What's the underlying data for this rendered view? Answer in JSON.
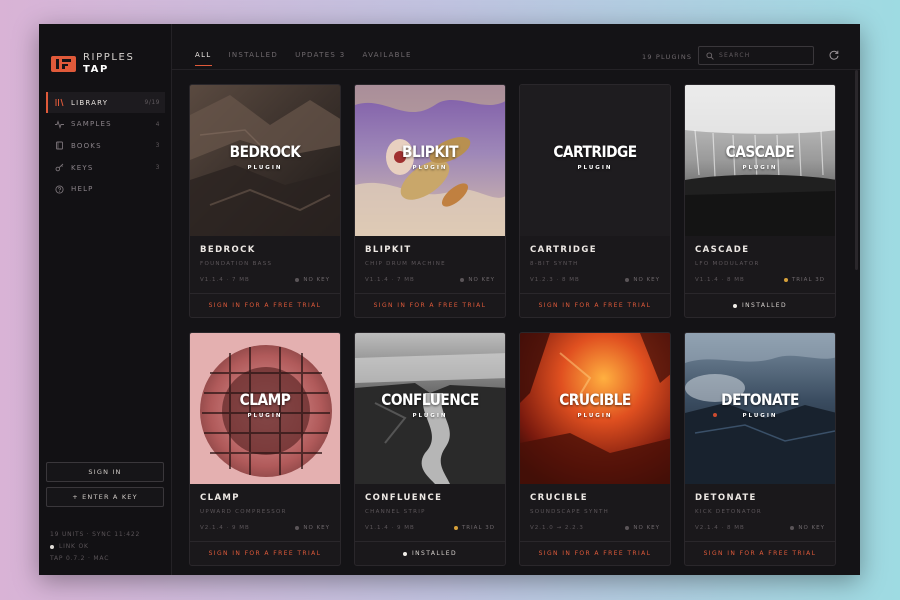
{
  "brand": {
    "line1": "RIPPLES",
    "line2": "TAP"
  },
  "sidebar": {
    "items": [
      {
        "label": "LIBRARY",
        "count": "9/19",
        "active": true,
        "icon": "library-icon"
      },
      {
        "label": "SAMPLES",
        "count": "4",
        "active": false,
        "icon": "waveform-icon"
      },
      {
        "label": "BOOKS",
        "count": "3",
        "active": false,
        "icon": "book-icon"
      },
      {
        "label": "KEYS",
        "count": "3",
        "active": false,
        "icon": "key-icon"
      },
      {
        "label": "HELP",
        "count": "",
        "active": false,
        "icon": "help-icon"
      }
    ],
    "sign_in_label": "SIGN IN",
    "enter_key_label": "+ ENTER A KEY",
    "footer": {
      "units": "19 UNITS · SYNC 11:422",
      "link": "LINK OK",
      "version": "TAP 0.7.2 · MAC"
    }
  },
  "topbar": {
    "tabs": [
      {
        "label": "ALL",
        "active": true
      },
      {
        "label": "INSTALLED",
        "active": false
      },
      {
        "label": "UPDATES 3",
        "active": false
      },
      {
        "label": "AVAILABLE",
        "active": false
      }
    ],
    "plugin_count": "19 PLUGINS",
    "search_placeholder": "SEARCH"
  },
  "colors": {
    "accent": "#e05a3a",
    "trial": "#d6a03a",
    "background": "#141316"
  },
  "plugins": [
    {
      "art_title": "BEDROCK",
      "art_sub": "PLUGIN",
      "name": "BEDROCK",
      "desc": "FOUNDATION BASS",
      "version": "V1.1.4 · 7 MB",
      "key": "NO KEY",
      "key_state": "none",
      "action": "SIGN IN FOR A FREE TRIAL",
      "installed": false
    },
    {
      "art_title": "BLIPKIT",
      "art_sub": "PLUGIN",
      "name": "BLIPKIT",
      "desc": "CHIP DRUM MACHINE",
      "version": "V1.1.4 · 7 MB",
      "key": "NO KEY",
      "key_state": "none",
      "action": "SIGN IN FOR A FREE TRIAL",
      "installed": false
    },
    {
      "art_title": "CARTRIDGE",
      "art_sub": "PLUGIN",
      "name": "CARTRIDGE",
      "desc": "8-BIT SYNTH",
      "version": "V1.2.3 · 8 MB",
      "key": "NO KEY",
      "key_state": "none",
      "action": "SIGN IN FOR A FREE TRIAL",
      "installed": false
    },
    {
      "art_title": "CASCADE",
      "art_sub": "PLUGIN",
      "name": "CASCADE",
      "desc": "LFO MODULATOR",
      "version": "V1.1.4 · 8 MB",
      "key": "TRIAL 3D",
      "key_state": "trial",
      "action": "INSTALLED",
      "installed": true
    },
    {
      "art_title": "CLAMP",
      "art_sub": "PLUGIN",
      "name": "CLAMP",
      "desc": "UPWARD COMPRESSOR",
      "version": "V2.1.4 · 9 MB",
      "key": "NO KEY",
      "key_state": "none",
      "action": "SIGN IN FOR A FREE TRIAL",
      "installed": false
    },
    {
      "art_title": "CONFLUENCE",
      "art_sub": "PLUGIN",
      "name": "CONFLUENCE",
      "desc": "CHANNEL STRIP",
      "version": "V1.1.4 · 9 MB",
      "key": "TRIAL 3D",
      "key_state": "trial",
      "action": "INSTALLED",
      "installed": true
    },
    {
      "art_title": "CRUCIBLE",
      "art_sub": "PLUGIN",
      "name": "CRUCIBLE",
      "desc": "SOUNDSCAPE SYNTH",
      "version": "V2.1.0 → 2.2.3",
      "key": "NO KEY",
      "key_state": "none",
      "action": "SIGN IN FOR A FREE TRIAL",
      "installed": false
    },
    {
      "art_title": "DETONATE",
      "art_sub": "PLUGIN",
      "name": "DETONATE",
      "desc": "KICK DETONATOR",
      "version": "V2.1.4 · 8 MB",
      "key": "NO KEY",
      "key_state": "none",
      "action": "SIGN IN FOR A FREE TRIAL",
      "installed": false
    }
  ]
}
